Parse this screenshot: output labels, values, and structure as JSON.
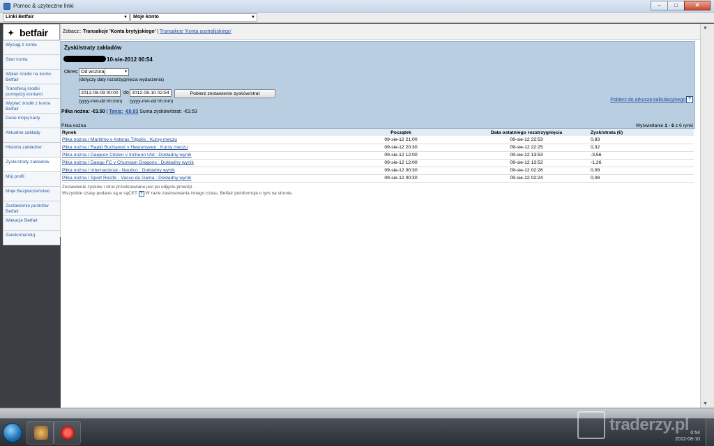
{
  "window": {
    "title": "Pomoc & uzyteczne linki",
    "min_label": "–",
    "max_label": "□",
    "close_label": "✕"
  },
  "dropdowns": {
    "links": "Linki Betfair",
    "account": "Moje konto",
    "arrow": "▼"
  },
  "brand": {
    "star": "✦",
    "word": "betfair"
  },
  "sidebar": {
    "items": [
      {
        "label": "Wyciąg z konta"
      },
      {
        "label": "Stan konta"
      },
      {
        "label": "Wpłać środki na konto Betfair"
      },
      {
        "label": "Transferuj środki pomiędzy kontami"
      },
      {
        "label": "Wypłać środki z konta Betfair"
      },
      {
        "label": "Dane mojej karty"
      },
      {
        "label": "Aktualne zakłady"
      },
      {
        "label": "Historia zakładów"
      },
      {
        "label": "Zyski/straty zakładów"
      },
      {
        "label": "Mój profil"
      },
      {
        "label": "Moje Bezpieczeństwo"
      },
      {
        "label": "Zestawienie punktów Betfair"
      },
      {
        "label": "Wakacje Betfair"
      },
      {
        "label": "Zarekomenduj"
      }
    ]
  },
  "see": {
    "prefix": "Zobacz::",
    "current": "Transakcje 'Konta brytyjskiego'",
    "separator": "|",
    "other": "Transakcje 'Konta australijskiego'"
  },
  "panel": {
    "title": "Zyski/straty zakładów",
    "date": "10-sie-2012 00:54",
    "okres_label": "Okres:",
    "okres_value": "Od wczoraj",
    "okres_note": "(dotyczy daty rozstrzygnięcia wydarzenia)",
    "from_value": "2012-08-09 00:00",
    "to_label": "do",
    "to_value": "2012-08-10 02:54",
    "format_hint": "(yyyy-mm-dd hh:mm)",
    "submit_label": "Pobierz zestawienie zysków/strat",
    "download_label": "Pobierz do arkusza kalkulacyjnego",
    "help_label": "?"
  },
  "summary": {
    "football_label": "Piłka nożna:",
    "football_value": "-€3.50",
    "sep": "|",
    "tennis_label": "Tenis:",
    "tennis_value": "-€0.03",
    "total_label": "Suma zysków/strat:",
    "total_value": "-€3.53"
  },
  "table": {
    "section": "Piłka nożna",
    "paging_prefix": "Wyświetlanie",
    "paging_range": "1 - 6",
    "paging_suffix": "z 6 rynki",
    "headers": {
      "market": "Rynek",
      "start": "Początek",
      "settled": "Data ostatniego rozstrzygnięcia",
      "pl": "Zysk/strata (€)"
    },
    "rows": [
      {
        "market": "Piłka nożna / Maritimo v Asteras Tripolis : Kursy meczu",
        "start": "09-sie-12 21:00",
        "settled": "09-sie-12 22:53",
        "pl": "0,83"
      },
      {
        "market": "Piłka nożna / Rapid Bucharest v Heerenveen : Kursy meczu",
        "start": "09-sie-12 20:30",
        "settled": "09-sie-12 22:25",
        "pl": "0,32"
      },
      {
        "market": "Piłka nożna / Daejeon Citizen v Incheon Utd : Dokładny wynik",
        "start": "09-sie-12 12:00",
        "settled": "09-sie-12 13:53",
        "pl": "-3,56"
      },
      {
        "market": "Piłka nożna / Daegu FC v Chunnam Dragons : Dokładny wynik",
        "start": "09-sie-12 12:00",
        "settled": "09-sie-12 13:52",
        "pl": "-1,26"
      },
      {
        "market": "Piłka nożna / Internacional - Nautico : Dokładny wynik",
        "start": "09-sie-12 00:30",
        "settled": "09-sie-12 02:26",
        "pl": "0,09"
      },
      {
        "market": "Piłka nożna / Sport Recife - Vasco da Gama : Dokładny wynik",
        "start": "09-sie-12 00:30",
        "settled": "09-sie-12 02:24",
        "pl": "0,08"
      }
    ]
  },
  "footnotes": {
    "line1": "Zestawienie zysków i strat przedstawiane jest po odjęciu prowizji.",
    "line2_prefix": "Wszystkie czasy podane są w sąCET",
    "line2_q": "?",
    "line2_suffix": "W razie zastosowania innego czasu, Betfair poinformuje o tym na stronie."
  },
  "taskbar": {
    "watermark": "traderzy.pl",
    "clock_time": "0:54",
    "clock_date": "2012-08-10"
  },
  "colors": {
    "link": "#1f4f9a",
    "panel": "#b9cfe1",
    "header_row": "#e3ebf3"
  }
}
